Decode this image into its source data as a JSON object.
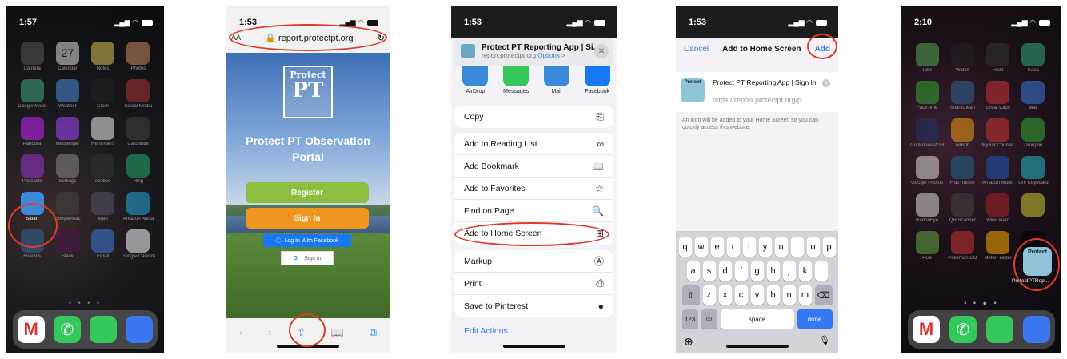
{
  "phone1": {
    "time": "1:57",
    "apps": [
      {
        "label": "Camera",
        "color": "#555"
      },
      {
        "label": "Calendar",
        "color": "#ddd",
        "icon_text": "27"
      },
      {
        "label": "Notes",
        "color": "#d9c35a"
      },
      {
        "label": "Photos",
        "color": "#c86"
      },
      {
        "label": "Google Maps",
        "color": "#4a8"
      },
      {
        "label": "Weather",
        "color": "#4a8ad9"
      },
      {
        "label": "Clock",
        "color": "#222"
      },
      {
        "label": "Social Media",
        "color": "#a33"
      },
      {
        "label": "Pandora",
        "color": "#c2f"
      },
      {
        "label": "Messenger",
        "color": "#a4f"
      },
      {
        "label": "Reminders",
        "color": "#eee"
      },
      {
        "label": "Calculator",
        "color": "#444"
      },
      {
        "label": "Podcasts",
        "color": "#93c"
      },
      {
        "label": "Settings",
        "color": "#888"
      },
      {
        "label": "ecobee",
        "color": "#333"
      },
      {
        "label": "Ring",
        "color": "#2a6"
      },
      {
        "label": "Safari",
        "color": "#3b8ad9"
      },
      {
        "label": "Google/Mac",
        "color": "#444"
      },
      {
        "label": "Web",
        "color": "#556"
      },
      {
        "label": "Amazon Alexa",
        "color": "#2ad"
      },
      {
        "label": "Blue Iris",
        "color": "#369"
      },
      {
        "label": "Slack",
        "color": "#4a154b"
      },
      {
        "label": "Email",
        "color": "#3b7ad9"
      },
      {
        "label": "Google Calendar",
        "color": "#fff"
      }
    ],
    "dock": [
      {
        "name": "gmail-icon",
        "color": "#fff"
      },
      {
        "name": "phone-icon",
        "color": "#34c759"
      },
      {
        "name": "messages-icon",
        "color": "#34c759"
      },
      {
        "name": "signal-icon",
        "color": "#3a76f0"
      }
    ]
  },
  "phone2": {
    "time": "1:53",
    "text_size": "AA",
    "url": "report.protectpt.org",
    "logo_line1": "Protect",
    "logo_line2": "PT",
    "title": "Protect PT Observation Portal",
    "register": "Register",
    "signin": "Sign In",
    "facebook": "Log In With Facebook",
    "google": "Sign in",
    "colors": {
      "register": "#8cbf3f",
      "signin": "#f0961e"
    }
  },
  "phone3": {
    "time": "1:53",
    "header_title": "Protect PT Reporting App | Si...",
    "header_url": "report.protectpt.org",
    "header_options": "Options >",
    "share_targets": [
      {
        "label": "AirDrop",
        "color": "#3b8ad9"
      },
      {
        "label": "Messages",
        "color": "#34c759"
      },
      {
        "label": "Mail",
        "color": "#3b8ad9"
      },
      {
        "label": "Facebook",
        "color": "#1877f2"
      }
    ],
    "group1": [
      {
        "label": "Copy",
        "sym": "⎘"
      }
    ],
    "group2": [
      {
        "label": "Add to Reading List",
        "sym": "∞"
      },
      {
        "label": "Add Bookmark",
        "sym": "📖"
      },
      {
        "label": "Add to Favorites",
        "sym": "☆"
      },
      {
        "label": "Find on Page",
        "sym": "🔍"
      },
      {
        "label": "Add to Home Screen",
        "sym": "⊞"
      }
    ],
    "group3": [
      {
        "label": "Markup",
        "sym": "Ⓐ"
      },
      {
        "label": "Print",
        "sym": "⎙"
      },
      {
        "label": "Save to Pinterest",
        "sym": "●"
      }
    ],
    "edit_actions": "Edit Actions..."
  },
  "phone4": {
    "time": "1:53",
    "cancel": "Cancel",
    "title": "Add to Home Screen",
    "add": "Add",
    "icon_text": "Protect",
    "name_value": "Protect PT Reporting App | Sign In",
    "url": "https://report.protectpt.org/p...",
    "note": "An icon will be added to your Home Screen so you can quickly access this website.",
    "keys_row1": [
      "q",
      "w",
      "e",
      "r",
      "t",
      "y",
      "u",
      "i",
      "o",
      "p"
    ],
    "keys_row2": [
      "a",
      "s",
      "d",
      "f",
      "g",
      "h",
      "j",
      "k",
      "l"
    ],
    "keys_row3": [
      "z",
      "x",
      "c",
      "v",
      "b",
      "n",
      "m"
    ],
    "shift": "⇧",
    "backspace": "⌫",
    "num": "123",
    "emoji": "☺",
    "space": "space",
    "done": "done",
    "globe": "⊕",
    "mic": "🎙"
  },
  "phone5": {
    "time": "2:10",
    "apps": [
      {
        "label": "Tabs",
        "color": "#5a5"
      },
      {
        "label": "Watch",
        "color": "#222"
      },
      {
        "label": "Flickr",
        "color": "#333"
      },
      {
        "label": "Kasa",
        "color": "#3a8"
      },
      {
        "label": "FaceTime",
        "color": "#3a3"
      },
      {
        "label": "SharkClean",
        "color": "#369"
      },
      {
        "label": "Great Clips",
        "color": "#c33"
      },
      {
        "label": "Mail",
        "color": "#3b7ad9"
      },
      {
        "label": "Go Mobile PGH",
        "color": "#236"
      },
      {
        "label": "AirBnb",
        "color": "#e91"
      },
      {
        "label": "MyBar Counter",
        "color": "#c33"
      },
      {
        "label": "Droupon",
        "color": "#3a3"
      },
      {
        "label": "Google Photos",
        "color": "#ddd"
      },
      {
        "label": "FracTracker",
        "color": "#268"
      },
      {
        "label": "Amazon Music",
        "color": "#25b"
      },
      {
        "label": "GIF Keyboard",
        "color": "#2bc"
      },
      {
        "label": "RadonEye",
        "color": "#ddd"
      },
      {
        "label": "QR Scanner",
        "color": "#444"
      },
      {
        "label": "WireGuard",
        "color": "#a22"
      },
      {
        "label": "",
        "color": "#cc3"
      },
      {
        "label": "PGe",
        "color": "#6a4"
      },
      {
        "label": "Pokémon GO",
        "color": "#c33"
      },
      {
        "label": "MeterFeeder",
        "color": "#fa0"
      },
      {
        "label": "",
        "color": "#000"
      }
    ],
    "new_app_label": "ProtectPTRep...",
    "new_app_icon": "Protect"
  }
}
